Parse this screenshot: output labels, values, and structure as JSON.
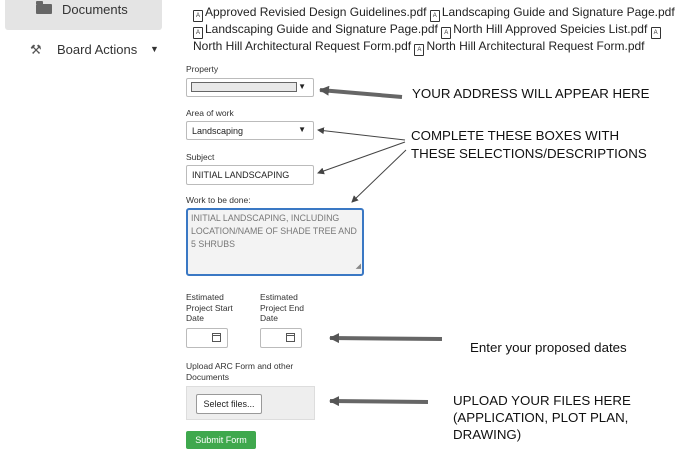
{
  "sidebar": {
    "documents_label": "Documents",
    "board_actions_label": "Board Actions"
  },
  "files": [
    "Approved Revisied Design Guidelines.pdf",
    "Landscaping Guide and Signature Page.pdf",
    "Landscaping Guide and Signature Page.pdf",
    "North Hill Approved Speicies List.pdf",
    "North Hill Architectural Request Form.pdf",
    "North Hill Architectural Request Form.pdf"
  ],
  "form": {
    "property_label": "Property",
    "area_label": "Area of work",
    "area_value": "Landscaping",
    "subject_label": "Subject",
    "subject_value": "INITIAL LANDSCAPING",
    "work_label": "Work to be done:",
    "work_value": "INITIAL LANDSCAPING, INCLUDING LOCATION/NAME OF SHADE TREE AND 5 SHRUBS",
    "start_label": "Estimated Project Start Date",
    "end_label": "Estimated Project End Date",
    "upload_label": "Upload ARC Form and other Documents",
    "select_files_label": "Select files...",
    "submit_label": "Submit Form"
  },
  "annotations": {
    "address": "YOUR ADDRESS WILL APPEAR HERE",
    "complete_line1": "COMPLETE THESE BOXES WITH",
    "complete_line2": "THESE SELECTIONS/DESCRIPTIONS",
    "dates": "Enter your proposed dates",
    "upload_line1": "UPLOAD YOUR FILES HERE",
    "upload_line2": "(APPLICATION, PLOT PLAN,",
    "upload_line3": "DRAWING)"
  },
  "colors": {
    "accent_blue": "#3a78c4",
    "submit_green": "#3fa84d"
  }
}
